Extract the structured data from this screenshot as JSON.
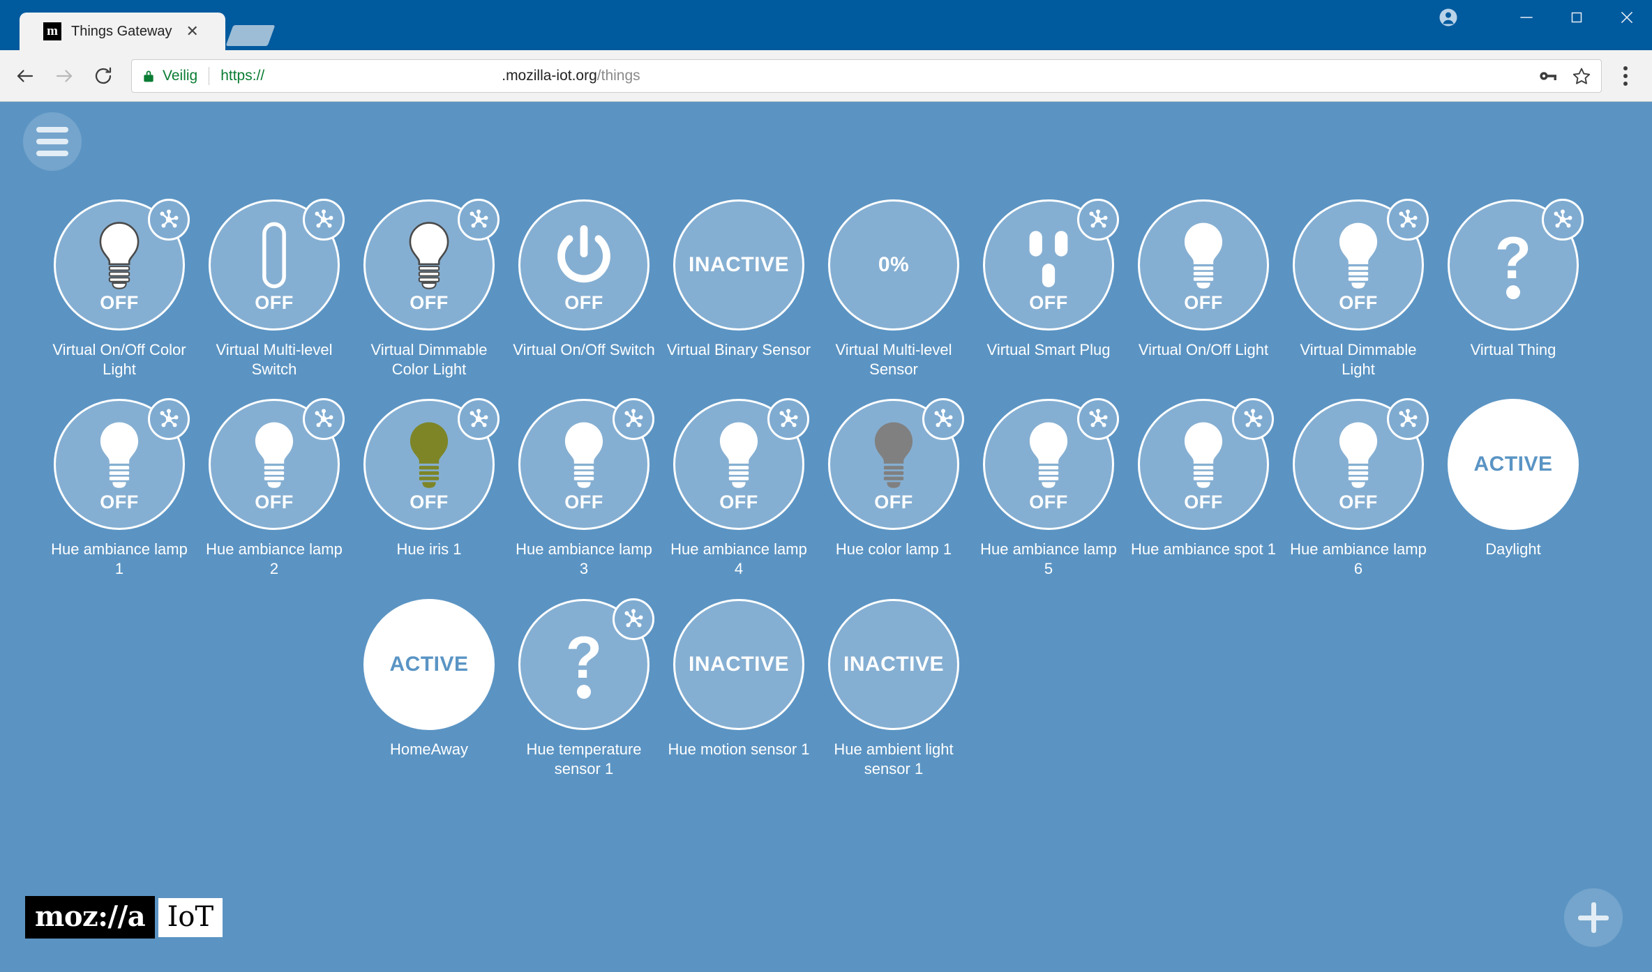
{
  "browser": {
    "tab": {
      "title": "Things Gateway",
      "favicon_label": "m",
      "close_label": "✕"
    },
    "window_controls": {
      "profile": "profile-icon",
      "minimize": "—",
      "maximize": "□",
      "close": "✕"
    },
    "toolbar": {
      "back_label": "←",
      "forward_label": "→",
      "reload_label": "⟳",
      "security_text": "Veilig",
      "scheme_text": "https://",
      "url_visible": ".mozilla-iot.org",
      "url_path": "/things",
      "save_password_icon": "key-icon",
      "bookmark_icon": "star-icon",
      "menu_icon": "three-dots-icon"
    }
  },
  "app": {
    "menu_button_label": "menu-icon",
    "add_button_label": "plus-icon",
    "logo": {
      "brand": "moz://a",
      "product": "IoT"
    },
    "things": [
      {
        "name": "Virtual On/Off Color Light",
        "state": "OFF",
        "icon": "bulb-outline",
        "bulb_color": "#ffffff",
        "has_network_badge": true
      },
      {
        "name": "Virtual Multi-level Switch",
        "state": "OFF",
        "icon": "level-switch",
        "has_network_badge": true
      },
      {
        "name": "Virtual Dimmable Color Light",
        "state": "OFF",
        "icon": "bulb-outline",
        "bulb_color": "#ffffff",
        "has_network_badge": true
      },
      {
        "name": "Virtual On/Off Switch",
        "state": "OFF",
        "icon": "power-icon",
        "has_network_badge": false
      },
      {
        "name": "Virtual Binary Sensor",
        "state": "INACTIVE",
        "icon": "state-text",
        "has_network_badge": false
      },
      {
        "name": "Virtual Multi-level Sensor",
        "state": "0%",
        "icon": "state-text",
        "has_network_badge": false
      },
      {
        "name": "Virtual Smart Plug",
        "state": "OFF",
        "icon": "outlet-icon",
        "has_network_badge": true
      },
      {
        "name": "Virtual On/Off Light",
        "state": "OFF",
        "icon": "bulb-solid",
        "bulb_color": "#ffffff",
        "has_network_badge": false
      },
      {
        "name": "Virtual Dimmable Light",
        "state": "OFF",
        "icon": "bulb-solid",
        "bulb_color": "#ffffff",
        "has_network_badge": true
      },
      {
        "name": "Virtual Thing",
        "state": "",
        "icon": "question-icon",
        "has_network_badge": true
      },
      {
        "name": "Hue ambiance lamp 1",
        "state": "OFF",
        "icon": "bulb-solid",
        "bulb_color": "#ffffff",
        "has_network_badge": true
      },
      {
        "name": "Hue ambiance lamp 2",
        "state": "OFF",
        "icon": "bulb-solid",
        "bulb_color": "#ffffff",
        "has_network_badge": true
      },
      {
        "name": "Hue iris 1",
        "state": "OFF",
        "icon": "bulb-solid",
        "bulb_color": "#7d8527",
        "has_network_badge": true
      },
      {
        "name": "Hue ambiance lamp 3",
        "state": "OFF",
        "icon": "bulb-solid",
        "bulb_color": "#ffffff",
        "has_network_badge": true
      },
      {
        "name": "Hue ambiance lamp 4",
        "state": "OFF",
        "icon": "bulb-solid",
        "bulb_color": "#ffffff",
        "has_network_badge": true
      },
      {
        "name": "Hue color lamp 1",
        "state": "OFF",
        "icon": "bulb-solid",
        "bulb_color": "#808080",
        "has_network_badge": true
      },
      {
        "name": "Hue ambiance lamp 5",
        "state": "OFF",
        "icon": "bulb-solid",
        "bulb_color": "#ffffff",
        "has_network_badge": true
      },
      {
        "name": "Hue ambiance spot 1",
        "state": "OFF",
        "icon": "bulb-solid",
        "bulb_color": "#ffffff",
        "has_network_badge": true
      },
      {
        "name": "Hue ambiance lamp 6",
        "state": "OFF",
        "icon": "bulb-solid",
        "bulb_color": "#ffffff",
        "has_network_badge": true
      },
      {
        "name": "Daylight",
        "state": "ACTIVE",
        "icon": "state-text",
        "solid": true,
        "has_network_badge": false
      },
      {
        "name": "",
        "state": "",
        "icon": "spacer",
        "spacer": true
      },
      {
        "name": "",
        "state": "",
        "icon": "spacer",
        "spacer": true
      },
      {
        "name": "HomeAway",
        "state": "ACTIVE",
        "icon": "state-text",
        "solid": true,
        "has_network_badge": false
      },
      {
        "name": "Hue temperature sensor 1",
        "state": "",
        "icon": "question-icon",
        "has_network_badge": true
      },
      {
        "name": "Hue motion sensor 1",
        "state": "INACTIVE",
        "icon": "state-text",
        "has_network_badge": false
      },
      {
        "name": "Hue ambient light sensor 1",
        "state": "INACTIVE",
        "icon": "state-text",
        "has_network_badge": false
      }
    ]
  },
  "colors": {
    "chrome_blue": "#005a9e",
    "app_background": "#5b94c3",
    "circle_fill": "rgba(255,255,255,0.26)",
    "accent_text": "#5a94c4",
    "secure_green": "#0a7c33"
  }
}
